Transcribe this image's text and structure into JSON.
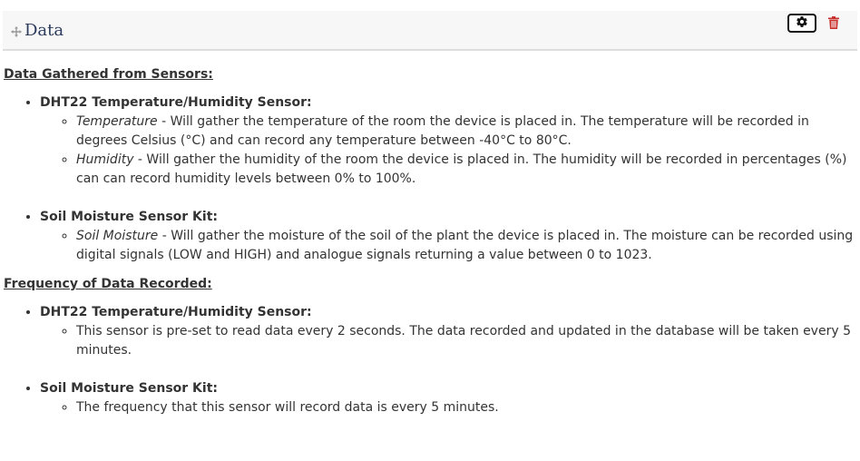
{
  "header": {
    "title": "Data",
    "icons": {
      "move": "move-icon",
      "settings": "gear-icon",
      "delete": "trash-icon"
    },
    "colors": {
      "title": "#2a3a5c",
      "delete_icon": "#c9302c"
    }
  },
  "sections": [
    {
      "heading": "Data Gathered from Sensors:",
      "sensors": [
        {
          "name": "DHT22 Temperature/Humidity Sensor:",
          "details": [
            {
              "term": "Temperature",
              "text": " - Will gather the temperature of the room the device is placed in. The temperature will be recorded in degrees Celsius (°C) and can record any temperature between -40°C to 80°C."
            },
            {
              "term": "Humidity",
              "text": " - Will gather the humidity of the room the device is placed in. The humidity will be recorded in percentages (%) can can record humidity levels between 0% to 100%."
            }
          ]
        },
        {
          "name": "Soil Moisture Sensor Kit:",
          "details": [
            {
              "term": "Soil Moisture",
              "text": " - Will gather the moisture of the soil of the plant the device is placed in. The moisture can be recorded using digital signals (LOW and HIGH) and analogue signals returning a value between 0 to 1023."
            }
          ]
        }
      ]
    },
    {
      "heading": "Frequency of Data Recorded:",
      "sensors": [
        {
          "name": "DHT22 Temperature/Humidity Sensor:",
          "details": [
            {
              "term": "",
              "text": "This sensor is pre-set to read data every 2 seconds. The data recorded and updated in the database will be taken every 5 minutes."
            }
          ]
        },
        {
          "name": "Soil Moisture Sensor Kit:",
          "details": [
            {
              "term": "",
              "text": "The frequency that this sensor will record data is every 5 minutes."
            }
          ]
        }
      ]
    }
  ]
}
